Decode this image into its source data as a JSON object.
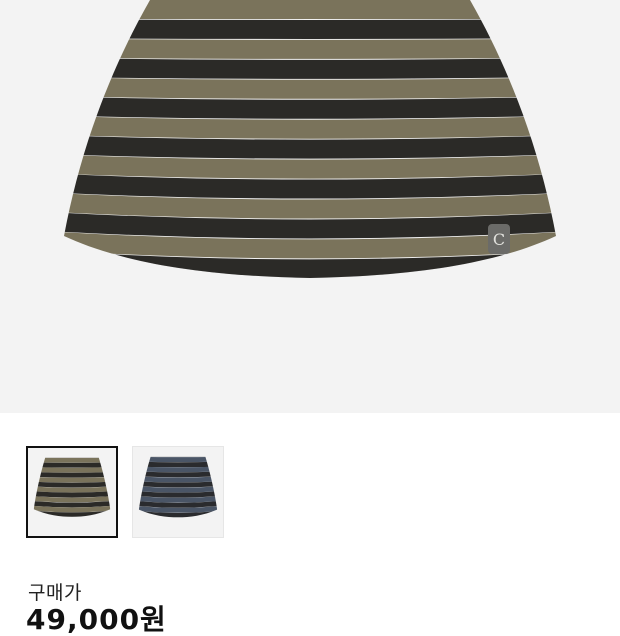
{
  "product": {
    "images": [
      {
        "label": "olive-black-stripe",
        "selected": true,
        "stripe_a": "#7a735b",
        "stripe_b": "#2b2a27"
      },
      {
        "label": "navy-black-stripe",
        "selected": false,
        "stripe_a": "#4a5566",
        "stripe_b": "#2a2b2e"
      }
    ],
    "badge_letter": "C"
  },
  "price": {
    "label": "구매가",
    "value": "49,000원"
  },
  "colors": {
    "hero_bg": "#f3f3f3",
    "selected_border": "#111111",
    "badge": "#6b6b68"
  }
}
